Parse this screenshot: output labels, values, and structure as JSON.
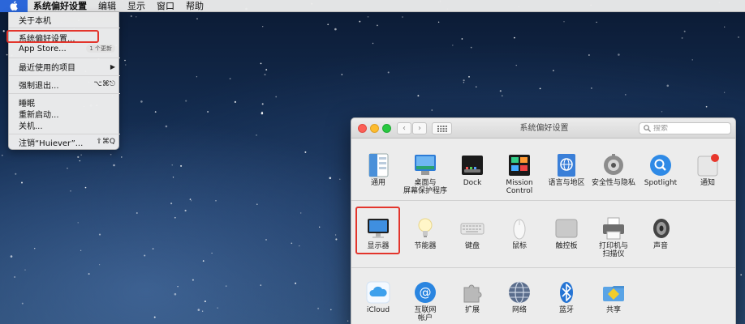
{
  "menubar": {
    "apple_icon": "apple-logo-icon",
    "items": [
      "系统偏好设置",
      "编辑",
      "显示",
      "窗口",
      "帮助"
    ]
  },
  "apple_menu": {
    "about": "关于本机",
    "system_prefs": "系统偏好设置...",
    "app_store": "App Store...",
    "app_store_badge": "1 个更新",
    "recent_items": "最近使用的项目",
    "recent_items_arrow": "▶",
    "force_quit": "强制退出...",
    "force_quit_shortcut": "⌥⌘⎋",
    "sleep": "睡眠",
    "restart": "重新启动...",
    "shutdown": "关机...",
    "logout": "注销“Huiever”...",
    "logout_shortcut": "⇧⌘Q"
  },
  "window": {
    "title": "系统偏好设置",
    "back": "‹",
    "forward": "›",
    "search_placeholder": "搜索"
  },
  "prefs_row1": [
    {
      "label": "通用",
      "icon": "general-icon"
    },
    {
      "label": "桌面与\n屏幕保护程序",
      "icon": "desktop-screensaver-icon"
    },
    {
      "label": "Dock",
      "icon": "dock-icon"
    },
    {
      "label": "Mission\nControl",
      "icon": "mission-control-icon"
    },
    {
      "label": "语言与地区",
      "icon": "language-region-icon"
    },
    {
      "label": "安全性与隐私",
      "icon": "security-privacy-icon"
    },
    {
      "label": "Spotlight",
      "icon": "spotlight-icon"
    },
    {
      "label": "通知",
      "icon": "notifications-icon"
    }
  ],
  "prefs_row2": [
    {
      "label": "显示器",
      "icon": "displays-icon"
    },
    {
      "label": "节能器",
      "icon": "energy-saver-icon"
    },
    {
      "label": "键盘",
      "icon": "keyboard-icon"
    },
    {
      "label": "鼠标",
      "icon": "mouse-icon"
    },
    {
      "label": "触控板",
      "icon": "trackpad-icon"
    },
    {
      "label": "打印机与\n扫描仪",
      "icon": "printers-scanners-icon"
    },
    {
      "label": "声音",
      "icon": "sound-icon"
    }
  ],
  "prefs_row3": [
    {
      "label": "iCloud",
      "icon": "icloud-icon"
    },
    {
      "label": "互联网\n帐户",
      "icon": "internet-accounts-icon"
    },
    {
      "label": "扩展",
      "icon": "extensions-icon"
    },
    {
      "label": "网络",
      "icon": "network-icon"
    },
    {
      "label": "蓝牙",
      "icon": "bluetooth-icon"
    },
    {
      "label": "共享",
      "icon": "sharing-icon"
    }
  ],
  "colors": {
    "highlight_red": "#e3352c",
    "menu_accent": "#2b66d9"
  }
}
